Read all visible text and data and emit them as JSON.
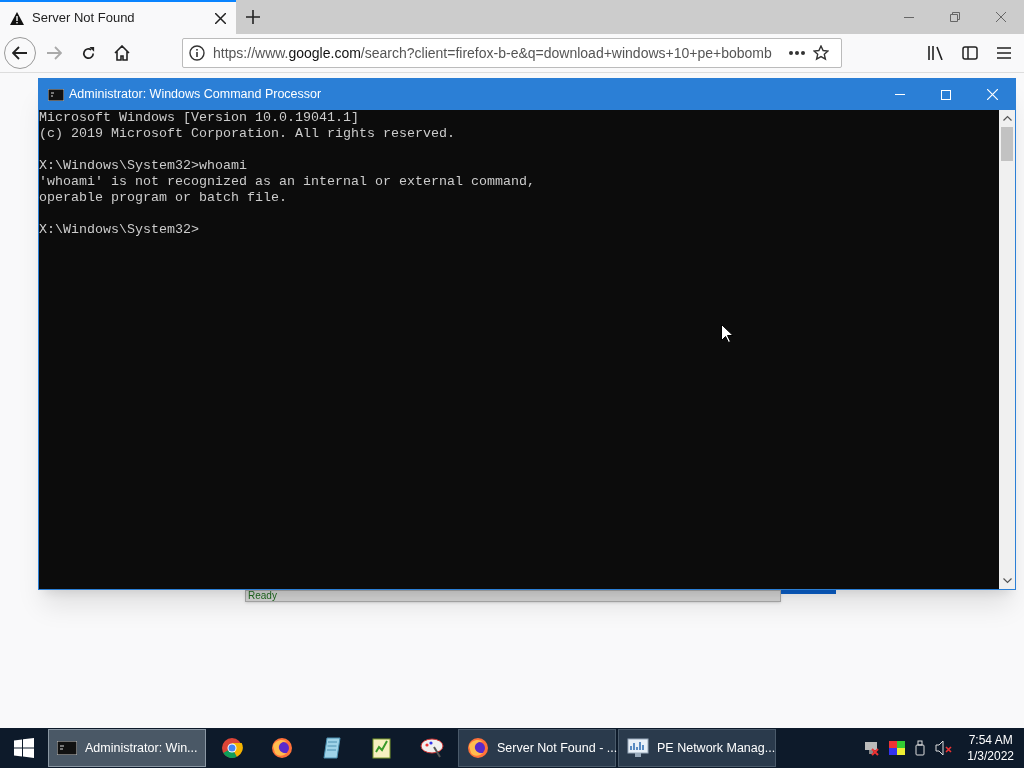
{
  "browser": {
    "tabs": [
      {
        "title": "Server Not Found",
        "selected": true
      }
    ],
    "address": "https://www.google.com/search?client=firefox-b-e&q=download+windows+10+pe+bobomb",
    "page": {
      "status_text": "Ready"
    }
  },
  "console_window": {
    "title": "Administrator: Windows Command Processor",
    "blocks": [
      [
        "Microsoft Windows [Version 10.0.19041.1]",
        "(c) 2019 Microsoft Corporation. All rights reserved."
      ],
      [
        "X:\\Windows\\System32>whoami",
        "'whoami' is not recognized as an internal or external command,",
        "operable program or batch file."
      ],
      [
        "X:\\Windows\\System32>"
      ]
    ]
  },
  "taskbar": {
    "items": [
      {
        "kind": "window",
        "label": "Administrator: Win...",
        "selected": true
      },
      {
        "kind": "pinned"
      },
      {
        "kind": "pinned"
      },
      {
        "kind": "pinned"
      },
      {
        "kind": "pinned"
      },
      {
        "kind": "pinned"
      },
      {
        "kind": "window",
        "label": "Server Not Found - ...",
        "selected": false
      },
      {
        "kind": "window",
        "label": "PE Network Manag...",
        "selected": false
      }
    ],
    "time": "7:54 AM",
    "date": "1/3/2022"
  }
}
